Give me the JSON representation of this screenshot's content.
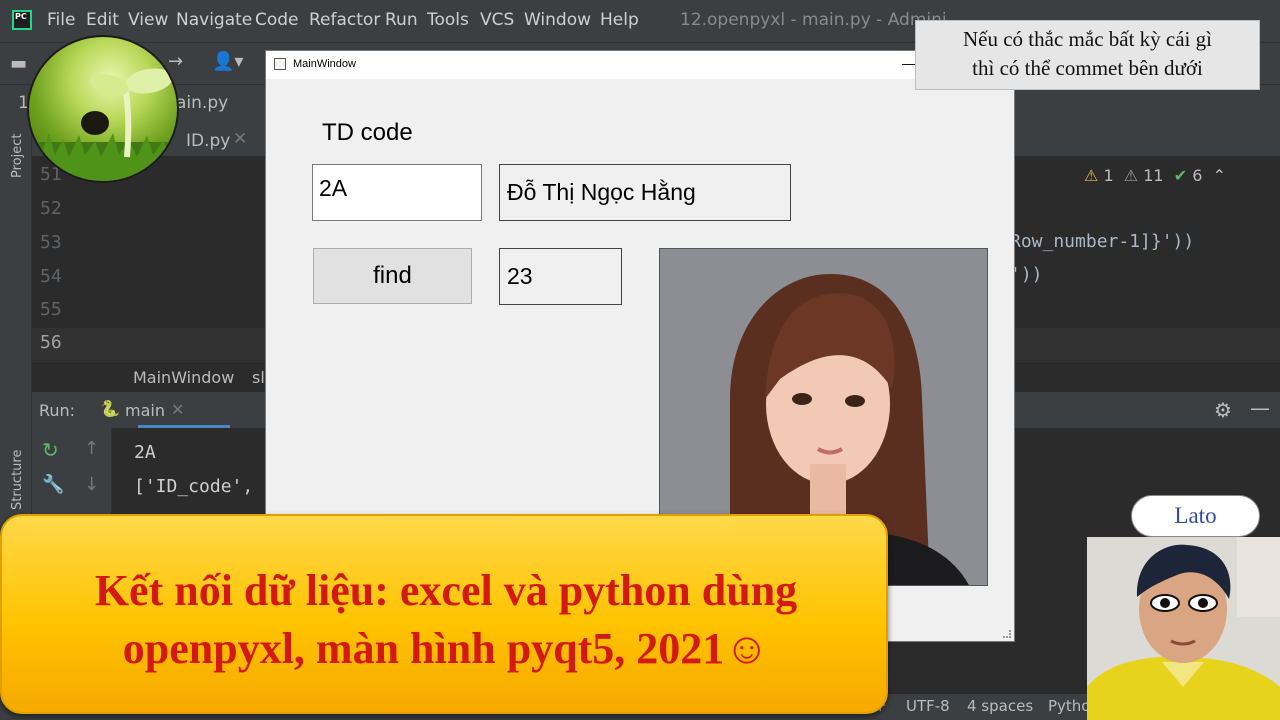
{
  "ide": {
    "menu": [
      "File",
      "Edit",
      "View",
      "Navigate",
      "Code",
      "Refactor",
      "Run",
      "Tools",
      "VCS",
      "Window",
      "Help"
    ],
    "window_title": "12.openpyxl - main.py - Admini",
    "tabs": {
      "partial_left": "1",
      "main_tab": "ain.py",
      "id_tab": "ID.py"
    },
    "side_labels": {
      "project": "Project",
      "structure": "Structure"
    },
    "line_numbers": [
      "51",
      "52",
      "53",
      "54",
      "55",
      "56"
    ],
    "code_fragments": {
      "line53": "Row_number-1]}'))",
      "line54": "'))"
    },
    "inspections": {
      "warnings": "1",
      "weak_warnings": "11",
      "ok": "6"
    },
    "breadcrumb": {
      "item1": "MainWindow",
      "item2": "sl"
    },
    "run": {
      "label": "Run:",
      "config": "main"
    },
    "console_lines": [
      "2A",
      "['ID_code',"
    ],
    "status": {
      "line_sep": "F",
      "encoding": "UTF-8",
      "indent": "4 spaces",
      "interpreter": "Pytho"
    }
  },
  "qt_window": {
    "title": "MainWindow",
    "label": "TD code",
    "code_input": "2A",
    "name_field": "Đỗ Thị Ngọc Hằng",
    "find_button": "find",
    "age_field": "23"
  },
  "note": {
    "line1": "Nếu có thắc mắc bất kỳ cái gì",
    "line2": "thì có thể commet bên dưới"
  },
  "banner": {
    "line1": "Kết nối dữ liệu: excel và python dùng",
    "line2": "openpyxl, màn hình pyqt5, 2021☺"
  },
  "presenter": {
    "name": "Lato"
  },
  "colors": {
    "banner_text": "#d31a12",
    "banner_bg": "#ffc300",
    "ide_bg": "#2b2b2b",
    "name_text": "#2f4f9e"
  }
}
